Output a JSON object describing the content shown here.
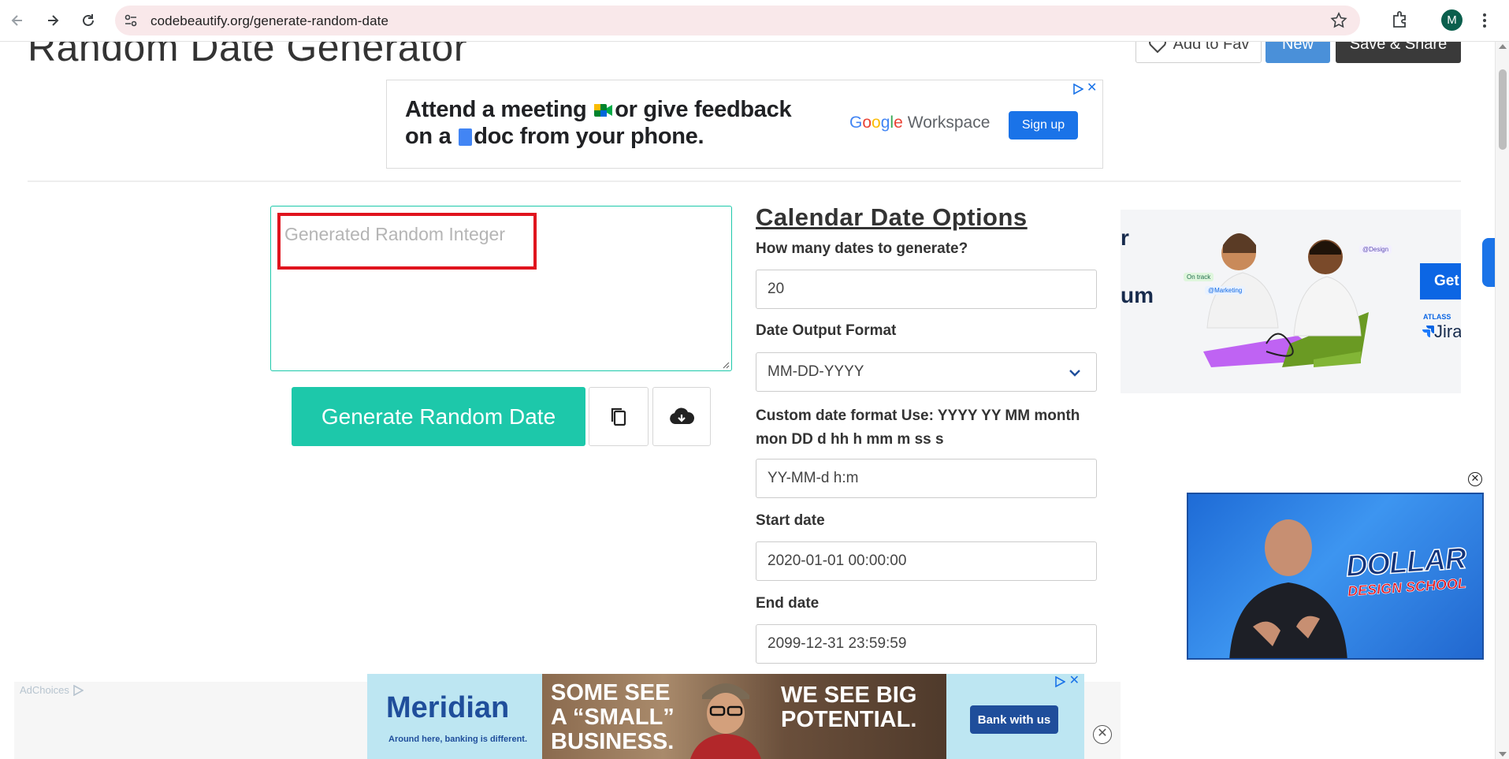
{
  "browser": {
    "url": "codebeautify.org/generate-random-date",
    "avatar_letter": "M"
  },
  "header": {
    "title": "Random Date Generator",
    "add_fav_label": "Add to Fav",
    "new_label": "New",
    "save_share_label": "Save & Share"
  },
  "top_ad": {
    "line1_a": "Attend a meeting",
    "line1_b": "or give feedback",
    "line2_a": "on a",
    "line2_b": "doc from your phone.",
    "brand_google": [
      "G",
      "o",
      "o",
      "g",
      "l",
      "e"
    ],
    "brand_product": "Workspace",
    "cta": "Sign up"
  },
  "output": {
    "placeholder": "Generated Random Integer"
  },
  "actions": {
    "generate_label": "Generate Random Date",
    "copy_icon": "copy-icon",
    "download_icon": "cloud-download-icon"
  },
  "options": {
    "title": "Calendar Date Options",
    "count_label": "How many dates to generate?",
    "count_value": "20",
    "format_label": "Date Output Format",
    "format_value": "MM-DD-YYYY",
    "custom_label": "Custom date format Use: YYYY YY MM month mon DD d hh h mm m ss s",
    "custom_value": "YY-MM-d h:m",
    "start_label": "Start date",
    "start_value": "2020-01-01 00:00:00",
    "end_label": "End date",
    "end_value": "2099-12-31 23:59:59"
  },
  "right_ad": {
    "partial_1": "r",
    "partial_2": "um",
    "cta": "Get",
    "tag_on_track": "On track",
    "tag_marketing": "@Marketing",
    "tag_design": "@Design",
    "brand_small": "ATLASS",
    "brand": "Jira"
  },
  "video_ad": {
    "logo_line1": "DOLLAR",
    "logo_line2": "DESIGN SCHOOL"
  },
  "bottom_ad": {
    "adchoices": "AdChoices",
    "brand": "Meridian",
    "tagline": "Around here, banking is different.",
    "headline_left": "SOME SEE A \"SMALL\" BUSINESS.",
    "headline_left_1": "SOME SEE",
    "headline_left_2": "A “SMALL”",
    "headline_left_3": "BUSINESS.",
    "headline_right_1": "WE SEE BIG",
    "headline_right_2": "POTENTIAL.",
    "cta": "Bank with us"
  },
  "colors": {
    "accent_teal": "#1dc8aa",
    "highlight_red": "#e0141e",
    "new_blue": "#4a90d9",
    "save_dark": "#3a3a3a"
  }
}
